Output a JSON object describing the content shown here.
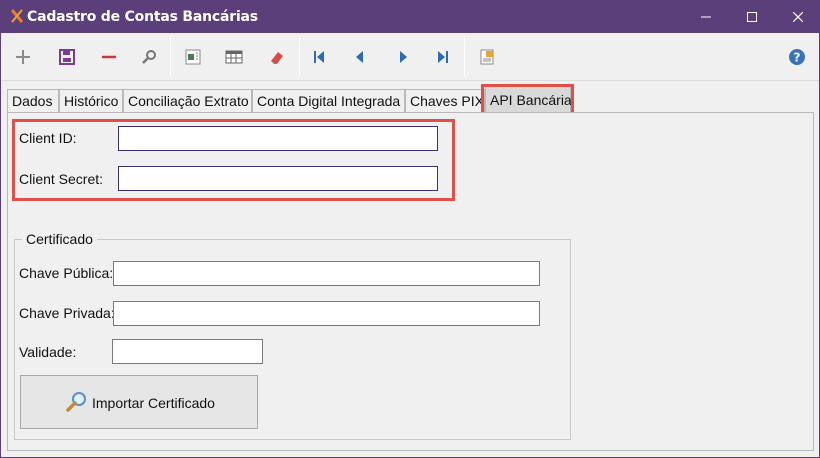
{
  "window": {
    "title": "Cadastro de Contas Bancárias"
  },
  "toolbar": {
    "buttons": [
      "add-icon",
      "save-icon",
      "delete-icon",
      "search-icon",
      "export-icon",
      "grid-icon",
      "eraser-icon",
      "first-record-icon",
      "previous-record-icon",
      "next-record-icon",
      "last-record-icon",
      "report-icon",
      "help-icon"
    ]
  },
  "tabs": [
    {
      "label": "Dados"
    },
    {
      "label": "Histórico"
    },
    {
      "label": "Conciliação Extrato"
    },
    {
      "label": "Conta Digital Integrada"
    },
    {
      "label": "Chaves PIX"
    },
    {
      "label": "API Bancária"
    }
  ],
  "api": {
    "client_id_label": "Client ID:",
    "client_id_value": "",
    "client_secret_label": "Client Secret:",
    "client_secret_value": ""
  },
  "certificado": {
    "group_title": "Certificado",
    "chave_publica_label": "Chave Pública:",
    "chave_publica_value": "",
    "chave_privada_label": "Chave Privada:",
    "chave_privada_value": "",
    "validade_label": "Validade:",
    "validade_value": "",
    "import_button_label": "Importar Certificado"
  },
  "colors": {
    "titlebar": "#5b3f7a",
    "highlight": "#e0504a",
    "toolbar_accent": "#7a3d8f"
  }
}
